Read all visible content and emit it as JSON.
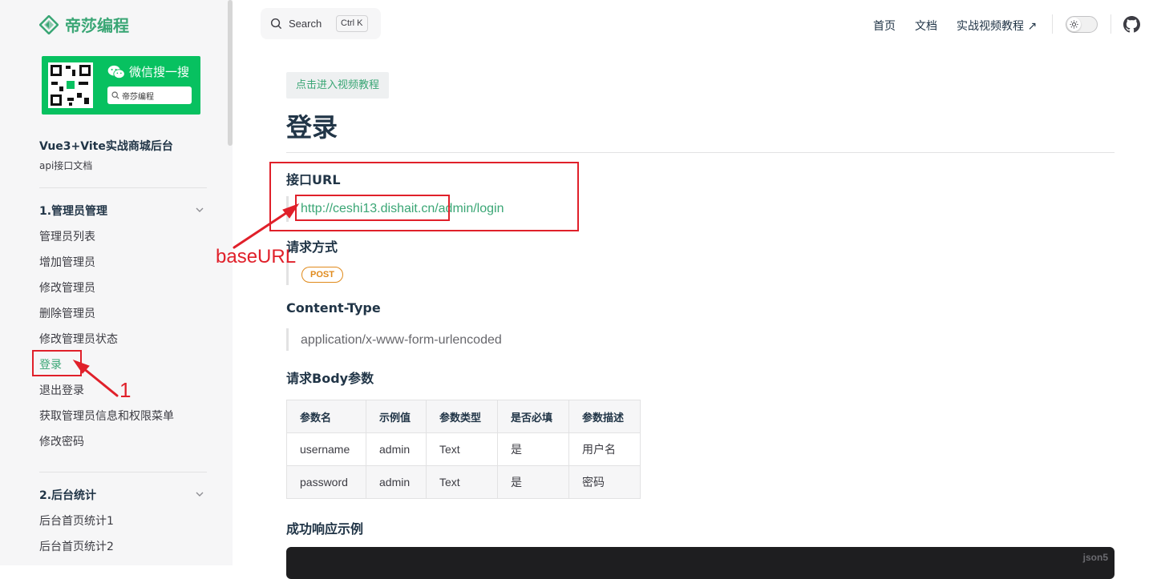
{
  "brand": {
    "name": "帝莎编程",
    "color": "#3aa675"
  },
  "wechat": {
    "title": "微信搜一搜",
    "search_text": "帝莎编程",
    "color": "#07c160"
  },
  "sidebar": {
    "doc_title": "Vue3+Vite实战商城后台",
    "doc_subtitle": "api接口文档",
    "groups": [
      {
        "title": "1.管理员管理",
        "items": [
          {
            "label": "管理员列表"
          },
          {
            "label": "增加管理员"
          },
          {
            "label": "修改管理员"
          },
          {
            "label": "删除管理员"
          },
          {
            "label": "修改管理员状态"
          },
          {
            "label": "登录",
            "active": true
          },
          {
            "label": "退出登录"
          },
          {
            "label": "获取管理员信息和权限菜单"
          },
          {
            "label": "修改密码"
          }
        ]
      },
      {
        "title": "2.后台统计",
        "items": [
          {
            "label": "后台首页统计1"
          },
          {
            "label": "后台首页统计2"
          }
        ]
      }
    ]
  },
  "header": {
    "search_label": "Search",
    "search_shortcut": "Ctrl K",
    "nav": [
      {
        "label": "首页"
      },
      {
        "label": "文档"
      },
      {
        "label": "实战视频教程 ↗"
      }
    ]
  },
  "content": {
    "video_link": "点击进入视频教程",
    "title": "登录",
    "url_heading": "接口URL",
    "url": "http://ceshi13.dishait.cn/admin/login",
    "method_heading": "请求方式",
    "method": "POST",
    "content_type_heading": "Content-Type",
    "content_type": "application/x-www-form-urlencoded",
    "body_heading": "请求Body参数",
    "table": {
      "headers": [
        "参数名",
        "示例值",
        "参数类型",
        "是否必填",
        "参数描述"
      ],
      "rows": [
        [
          "username",
          "admin",
          "Text",
          "是",
          "用户名"
        ],
        [
          "password",
          "admin",
          "Text",
          "是",
          "密码"
        ]
      ]
    },
    "response_heading": "成功响应示例",
    "code_lang": "json5"
  },
  "annotations": {
    "base_url_label": "baseURL",
    "step_label": "1",
    "color": "#e0202a"
  }
}
